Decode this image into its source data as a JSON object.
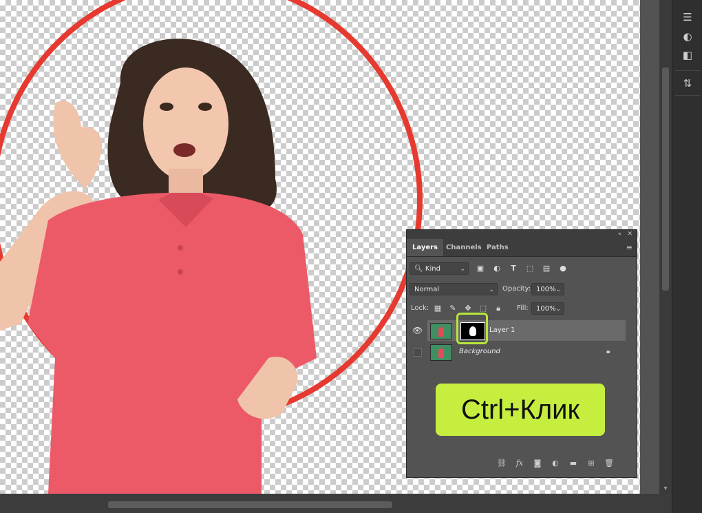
{
  "layers_panel": {
    "tabs": [
      {
        "label": "Layers",
        "active": true
      },
      {
        "label": "Channels",
        "active": false
      },
      {
        "label": "Paths",
        "active": false
      }
    ],
    "filter": {
      "kind_label": "Kind"
    },
    "blend_mode": "Normal",
    "opacity_label": "Opacity:",
    "opacity_value": "100%",
    "lock_label": "Lock:",
    "fill_label": "Fill:",
    "fill_value": "100%",
    "layers": [
      {
        "name": "Layer 1",
        "visible": true,
        "selected": true,
        "has_mask": true
      },
      {
        "name": "Background",
        "visible": false,
        "selected": false,
        "locked": true
      }
    ]
  },
  "callout": {
    "text": "Ctrl+Клик"
  },
  "colors": {
    "accent_highlight": "#b7e63b",
    "callout_bg": "#c5ee3f",
    "panel_bg": "#535353"
  }
}
